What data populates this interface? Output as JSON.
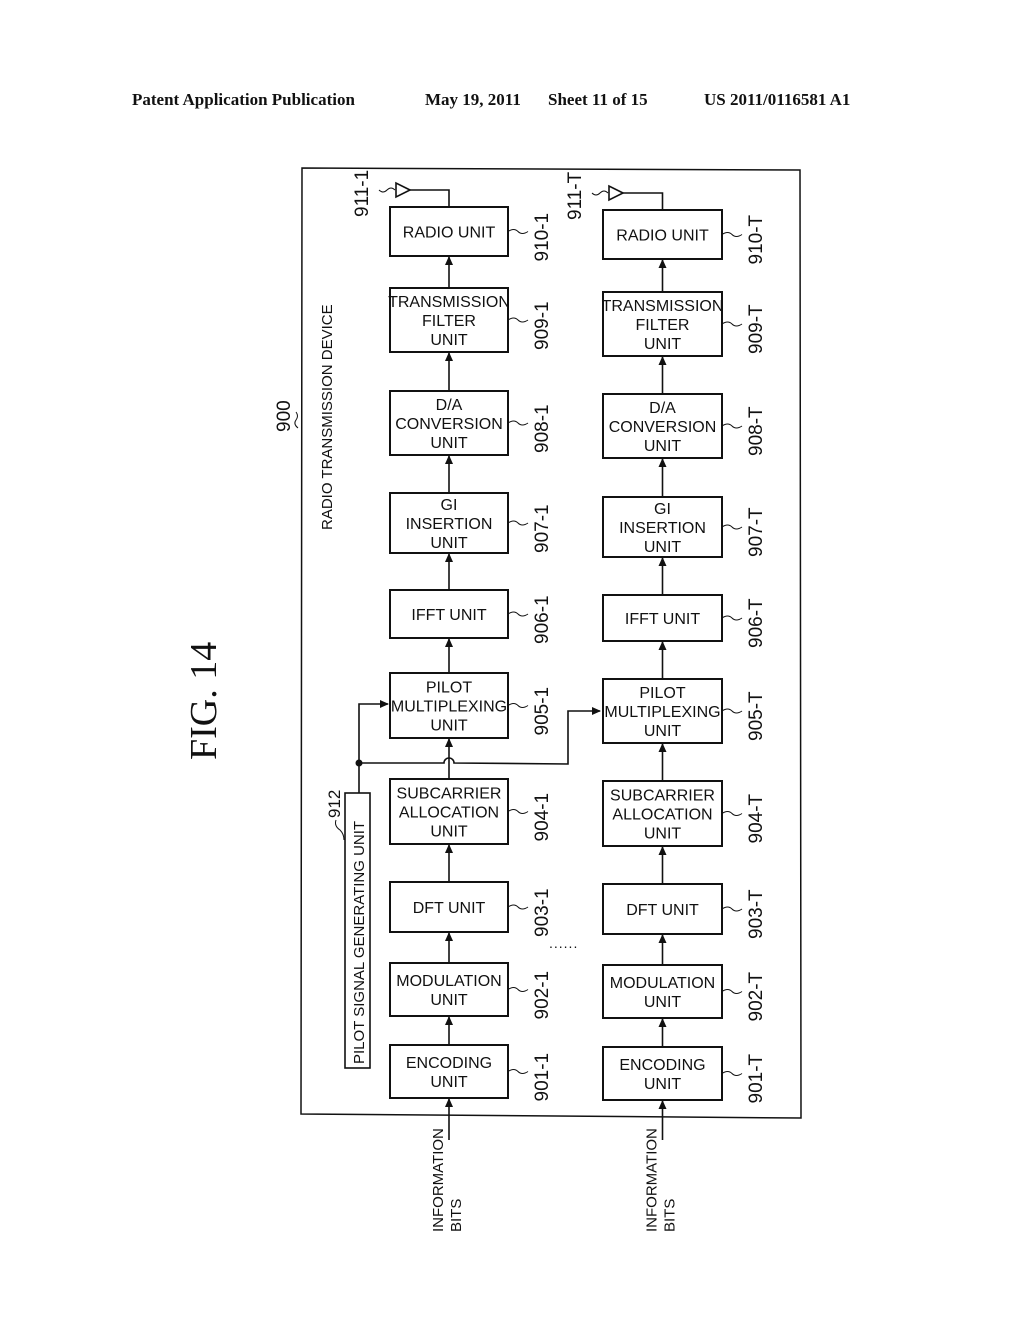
{
  "header": {
    "publication": "Patent Application Publication",
    "date": "May 19, 2011",
    "sheet": "Sheet 11 of 15",
    "number": "US 2011/0116581 A1"
  },
  "figure": {
    "title": "FIG. 14",
    "device_ref": "900",
    "device_label": "RADIO TRANSMISSION DEVICE",
    "pilot_unit": {
      "ref": "912",
      "label": "PILOT SIGNAL GENERATING UNIT"
    },
    "ellipsis": "......",
    "input_label": [
      "INFORMATION",
      "BITS"
    ],
    "chains": [
      {
        "suffix": "1",
        "antenna_ref": "911-1",
        "blocks": [
          {
            "ref": "901-1",
            "lines": [
              "ENCODING",
              "UNIT"
            ]
          },
          {
            "ref": "902-1",
            "lines": [
              "MODULATION",
              "UNIT"
            ]
          },
          {
            "ref": "903-1",
            "lines": [
              "DFT UNIT"
            ]
          },
          {
            "ref": "904-1",
            "lines": [
              "SUBCARRIER",
              "ALLOCATION",
              "UNIT"
            ]
          },
          {
            "ref": "905-1",
            "lines": [
              "PILOT",
              "MULTIPLEXING",
              "UNIT"
            ]
          },
          {
            "ref": "906-1",
            "lines": [
              "IFFT UNIT"
            ]
          },
          {
            "ref": "907-1",
            "lines": [
              "GI",
              "INSERTION",
              "UNIT"
            ]
          },
          {
            "ref": "908-1",
            "lines": [
              "D/A",
              "CONVERSION",
              "UNIT"
            ]
          },
          {
            "ref": "909-1",
            "lines": [
              "TRANSMISSION",
              "FILTER",
              "UNIT"
            ]
          },
          {
            "ref": "910-1",
            "lines": [
              "RADIO UNIT"
            ]
          }
        ]
      },
      {
        "suffix": "T",
        "antenna_ref": "911-T",
        "blocks": [
          {
            "ref": "901-T",
            "lines": [
              "ENCODING",
              "UNIT"
            ]
          },
          {
            "ref": "902-T",
            "lines": [
              "MODULATION",
              "UNIT"
            ]
          },
          {
            "ref": "903-T",
            "lines": [
              "DFT UNIT"
            ]
          },
          {
            "ref": "904-T",
            "lines": [
              "SUBCARRIER",
              "ALLOCATION",
              "UNIT"
            ]
          },
          {
            "ref": "905-T",
            "lines": [
              "PILOT",
              "MULTIPLEXING",
              "UNIT"
            ]
          },
          {
            "ref": "906-T",
            "lines": [
              "IFFT UNIT"
            ]
          },
          {
            "ref": "907-T",
            "lines": [
              "GI",
              "INSERTION",
              "UNIT"
            ]
          },
          {
            "ref": "908-T",
            "lines": [
              "D/A",
              "CONVERSION",
              "UNIT"
            ]
          },
          {
            "ref": "909-T",
            "lines": [
              "TRANSMISSION",
              "FILTER",
              "UNIT"
            ]
          },
          {
            "ref": "910-T",
            "lines": [
              "RADIO UNIT"
            ]
          }
        ]
      }
    ]
  }
}
